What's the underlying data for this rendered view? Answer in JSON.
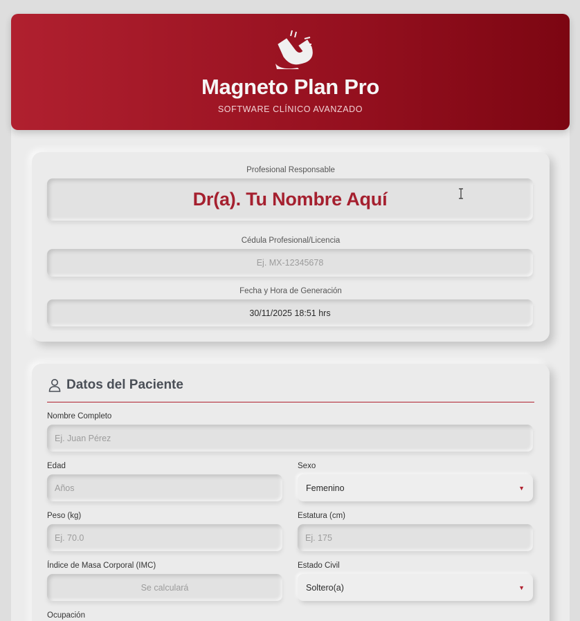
{
  "header": {
    "title": "Magneto Plan Pro",
    "subtitle": "SOFTWARE CLÍNICO AVANZADO",
    "logo_icon": "magnet-icon"
  },
  "professional": {
    "responsible_label": "Profesional Responsable",
    "doctor_name": "Dr(a). Tu Nombre Aquí",
    "license_label": "Cédula Profesional/Licencia",
    "license_placeholder": "Ej. MX-12345678",
    "datetime_label": "Fecha y Hora de Generación",
    "datetime_value": "30/11/2025 18:51 hrs"
  },
  "patient": {
    "section_title": "Datos del Paciente",
    "section_icon": "user-icon",
    "full_name_label": "Nombre Completo",
    "full_name_placeholder": "Ej. Juan Pérez",
    "age_label": "Edad",
    "age_placeholder": "Años",
    "sex_label": "Sexo",
    "sex_value": "Femenino",
    "weight_label": "Peso (kg)",
    "weight_placeholder": "Ej. 70.0",
    "height_label": "Estatura (cm)",
    "height_placeholder": "Ej. 175",
    "bmi_label": "Índice de Masa Corporal (IMC)",
    "bmi_placeholder": "Se calculará",
    "civil_label": "Estado Civil",
    "civil_value": "Soltero(a)",
    "occupation_label": "Ocupación"
  },
  "colors": {
    "brand_red": "#b0202f",
    "brand_dark": "#7c0612",
    "background": "#dedede"
  }
}
